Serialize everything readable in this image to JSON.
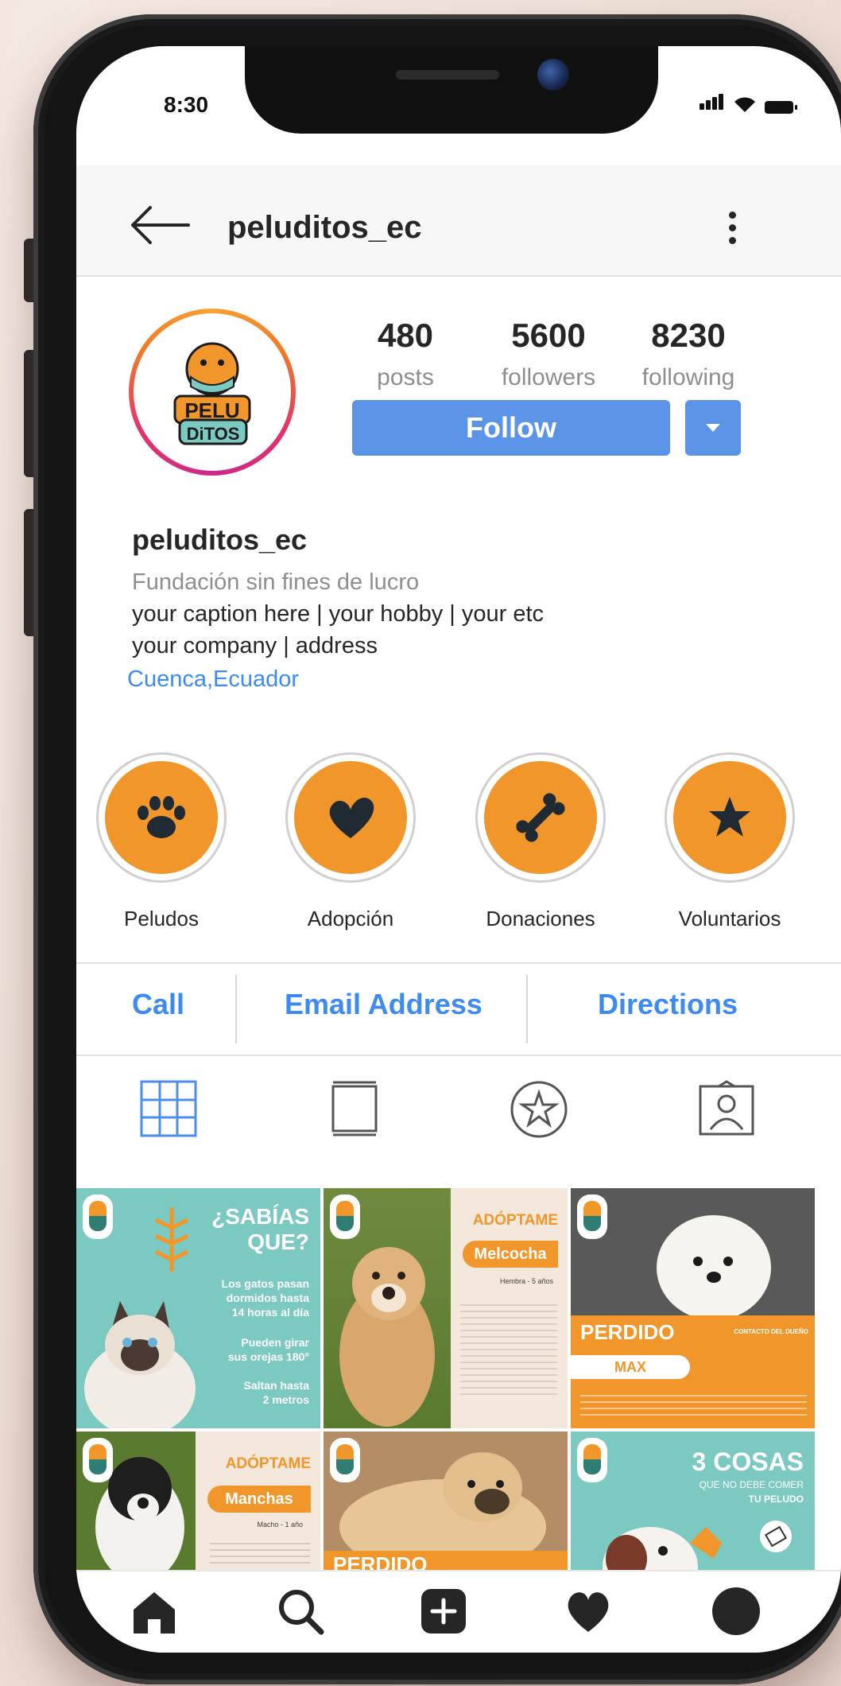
{
  "status": {
    "time": "8:30"
  },
  "header": {
    "username": "peluditos_ec"
  },
  "stats": [
    {
      "value": "480",
      "label": "posts"
    },
    {
      "value": "5600",
      "label": "followers"
    },
    {
      "value": "8230",
      "label": "following"
    }
  ],
  "actions": {
    "follow_label": "Follow"
  },
  "bio": {
    "name": "peluditos_ec",
    "category": "Fundación sin fines de lucro",
    "line1": "your caption here  | your hobby | your etc",
    "line2": "your company | address",
    "location": "Cuenca,Ecuador"
  },
  "highlights": [
    {
      "label": "Peludos",
      "icon": "paw-icon"
    },
    {
      "label": "Adopción",
      "icon": "heart-icon"
    },
    {
      "label": "Donaciones",
      "icon": "bone-icon"
    },
    {
      "label": "Voluntarios",
      "icon": "star-icon"
    }
  ],
  "contact": {
    "call": "Call",
    "email": "Email Address",
    "directions": "Directions"
  },
  "posts": {
    "p1": {
      "title1": "¿SABÍAS",
      "title2": "QUE?",
      "t1": "Los gatos pasan",
      "t2": "dormidos hasta",
      "t3": "14 horas al día",
      "t4": "Pueden girar",
      "t5": "sus orejas 180°",
      "t6": "Saltan hasta",
      "t7": "2 metros"
    },
    "p2": {
      "title": "ADÓPTAME",
      "name": "Melcocha",
      "sub": "Hembra - 5 años"
    },
    "p3": {
      "title": "PERDIDO",
      "name": "MAX",
      "contact": "CONTACTO DEL DUEÑO"
    },
    "p4": {
      "title": "ADÓPTAME",
      "name": "Manchas",
      "sub": "Macho - 1 año"
    },
    "p5": {
      "title": "PERDIDO"
    },
    "p6": {
      "title": "3 COSAS",
      "sub1": "QUE NO DEBE COMER",
      "sub2": "TU PELUDO"
    }
  },
  "colors": {
    "accent": "#5b93e6",
    "link": "#3d8bf0",
    "highlight": "#f0962a",
    "teal": "#7cc9c1",
    "orange": "#f0962a"
  }
}
